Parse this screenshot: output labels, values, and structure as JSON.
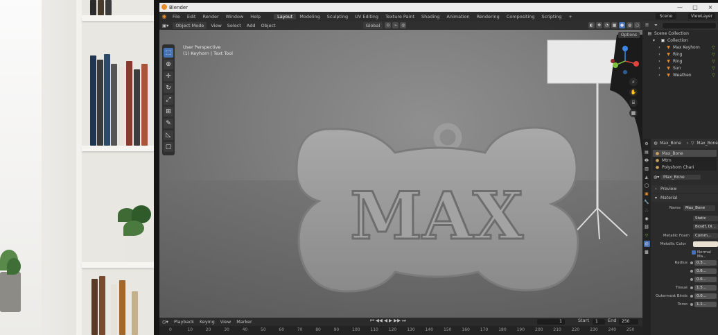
{
  "window": {
    "title": "Blender",
    "minimize": "—",
    "maximize": "□",
    "close": "×"
  },
  "menus": [
    "File",
    "Edit",
    "Render",
    "Window",
    "Help"
  ],
  "workspaces": [
    "Layout",
    "Modeling",
    "Sculpting",
    "UV Editing",
    "Texture Paint",
    "Shading",
    "Animation",
    "Rendering",
    "Compositing",
    "Scripting",
    "+"
  ],
  "active_workspace": "Layout",
  "scene": "Scene",
  "view_layer": "ViewLayer",
  "viewport_header": {
    "mode": "Object Mode",
    "menus": [
      "View",
      "Select",
      "Add",
      "Object"
    ],
    "orientation": "Global",
    "options": "Options"
  },
  "viewport_info": {
    "line1": "User Perspective",
    "line2": "(1) Keyhorn | Text Tool"
  },
  "model_text": "MAX",
  "timeline": {
    "playback": "Playback",
    "keying": "Keying",
    "view": "View",
    "marker": "Marker",
    "current_frame": "1",
    "start_label": "Start",
    "start": "1",
    "end_label": "End",
    "end": "250",
    "ticks": [
      "0",
      "10",
      "20",
      "30",
      "40",
      "50",
      "60",
      "70",
      "80",
      "90",
      "100",
      "110",
      "120",
      "130",
      "140",
      "150",
      "160",
      "170",
      "180",
      "190",
      "200",
      "210",
      "220",
      "230",
      "240",
      "250"
    ]
  },
  "outliner": {
    "root": "Scene Collection",
    "collection": "Collection",
    "items": [
      "Max Keyhorn",
      "Ring",
      "Ring",
      "Sun",
      "Weathen"
    ]
  },
  "properties": {
    "object": "Max_Bone",
    "material_tab": "Max_Bone",
    "slots": [
      "Max_Bone",
      "Mtrn",
      "Polyshom Chari"
    ],
    "material_field": "Max_Bone",
    "section_preview": "Preview",
    "section_material": "Material",
    "surface_label": "Name",
    "surface_value": "Max_Bone",
    "type_value": "Static",
    "shader_value": "Bxsdf, Dl...",
    "metallic_label": "Metallic Foam",
    "metallic_value": "Comm...",
    "base_label": "Metallic Color",
    "normal_label": "Normal Ma...",
    "rows": [
      {
        "label": "Radius",
        "value": "0.3..."
      },
      {
        "label": "",
        "value": "0.6..."
      },
      {
        "label": "",
        "value": "0.6..."
      },
      {
        "label": "Tissue",
        "value": "1.5..."
      },
      {
        "label": "Outermost Binds",
        "value": "0.0..."
      },
      {
        "label": "Torso",
        "value": "1.1..."
      }
    ]
  },
  "colors": {
    "accent": "#4772b3",
    "header": "#2b2b2b",
    "panel": "#282828",
    "orange": "#e88c2c",
    "x_axis": "#e0443e",
    "y_axis": "#7ec23d",
    "z_axis": "#3f87e6"
  }
}
